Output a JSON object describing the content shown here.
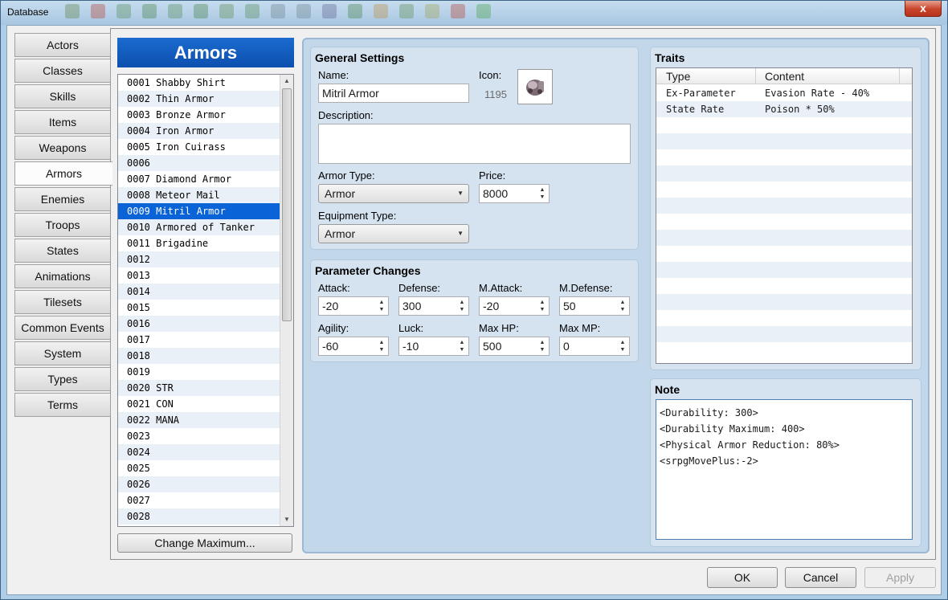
{
  "window": {
    "title": "Database",
    "close_label": "x"
  },
  "tabs": [
    "Actors",
    "Classes",
    "Skills",
    "Items",
    "Weapons",
    "Armors",
    "Enemies",
    "Troops",
    "States",
    "Animations",
    "Tilesets",
    "Common Events",
    "System",
    "Types",
    "Terms"
  ],
  "active_tab": "Armors",
  "list": {
    "header": "Armors",
    "items": [
      "0001 Shabby Shirt",
      "0002 Thin Armor",
      "0003 Bronze Armor",
      "0004 Iron Armor",
      "0005 Iron Cuirass",
      "0006",
      "0007 Diamond Armor",
      "0008 Meteor Mail",
      "0009 Mitril Armor",
      "0010 Armored of Tanker",
      "0011 Brigadine",
      "0012",
      "0013",
      "0014",
      "0015",
      "0016",
      "0017",
      "0018",
      "0019",
      "0020 STR",
      "0021 CON",
      "0022 MANA",
      "0023",
      "0024",
      "0025",
      "0026",
      "0027",
      "0028"
    ],
    "selected_index": 8,
    "change_max_label": "Change Maximum..."
  },
  "general": {
    "title": "General Settings",
    "name_label": "Name:",
    "name_value": "Mitril Armor",
    "icon_label": "Icon:",
    "icon_index": "1195",
    "description_label": "Description:",
    "description_value": "",
    "armor_type_label": "Armor Type:",
    "armor_type_value": "Armor",
    "price_label": "Price:",
    "price_value": "8000",
    "equip_type_label": "Equipment Type:",
    "equip_type_value": "Armor"
  },
  "params": {
    "title": "Parameter Changes",
    "fields": [
      {
        "label": "Attack:",
        "value": "-20"
      },
      {
        "label": "Defense:",
        "value": "300"
      },
      {
        "label": "M.Attack:",
        "value": "-20"
      },
      {
        "label": "M.Defense:",
        "value": "50"
      },
      {
        "label": "Agility:",
        "value": "-60"
      },
      {
        "label": "Luck:",
        "value": "-10"
      },
      {
        "label": "Max HP:",
        "value": "500"
      },
      {
        "label": "Max MP:",
        "value": "0"
      }
    ]
  },
  "traits": {
    "title": "Traits",
    "col_type": "Type",
    "col_content": "Content",
    "rows": [
      {
        "type": "Ex-Parameter",
        "content": "Evasion Rate - 40%"
      },
      {
        "type": "State Rate",
        "content": "Poison * 50%"
      }
    ]
  },
  "note": {
    "title": "Note",
    "lines": [
      "<Durability: 300>",
      "<Durability Maximum: 400>",
      "<Physical Armor Reduction: 80%>",
      "<srpgMovePlus:-2>"
    ]
  },
  "footer": {
    "ok": "OK",
    "cancel": "Cancel",
    "apply": "Apply"
  },
  "colors": {
    "selection": "#0a64d8",
    "header_blue": "#0d4fae"
  }
}
